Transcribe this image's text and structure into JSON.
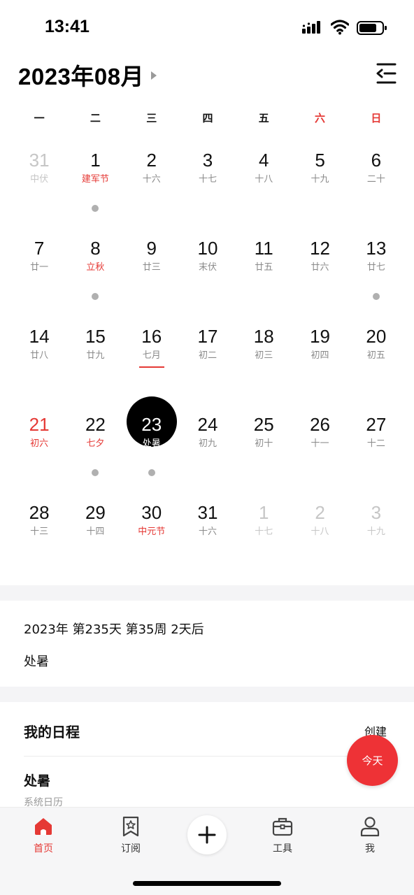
{
  "status": {
    "time": "13:41"
  },
  "header": {
    "month_title": "2023年08月"
  },
  "weekdays": [
    "一",
    "二",
    "三",
    "四",
    "五",
    "六",
    "日"
  ],
  "weeks": [
    [
      {
        "num": "31",
        "sub": "中伏",
        "other": true
      },
      {
        "num": "1",
        "sub": "建军节",
        "red_sub": true,
        "dot": true
      },
      {
        "num": "2",
        "sub": "十六"
      },
      {
        "num": "3",
        "sub": "十七"
      },
      {
        "num": "4",
        "sub": "十八"
      },
      {
        "num": "5",
        "sub": "十九"
      },
      {
        "num": "6",
        "sub": "二十"
      }
    ],
    [
      {
        "num": "7",
        "sub": "廿一"
      },
      {
        "num": "8",
        "sub": "立秋",
        "red_sub": true,
        "dot": true
      },
      {
        "num": "9",
        "sub": "廿三"
      },
      {
        "num": "10",
        "sub": "末伏"
      },
      {
        "num": "11",
        "sub": "廿五"
      },
      {
        "num": "12",
        "sub": "廿六"
      },
      {
        "num": "13",
        "sub": "廿七",
        "dot": true
      }
    ],
    [
      {
        "num": "14",
        "sub": "廿八"
      },
      {
        "num": "15",
        "sub": "廿九"
      },
      {
        "num": "16",
        "sub": "七月",
        "underline": true
      },
      {
        "num": "17",
        "sub": "初二"
      },
      {
        "num": "18",
        "sub": "初三"
      },
      {
        "num": "19",
        "sub": "初四"
      },
      {
        "num": "20",
        "sub": "初五"
      }
    ],
    [
      {
        "num": "21",
        "sub": "初六",
        "red_num": true,
        "red_sub": true
      },
      {
        "num": "22",
        "sub": "七夕",
        "red_sub": true,
        "dot": true
      },
      {
        "num": "23",
        "sub": "处暑",
        "selected": true,
        "dot": true
      },
      {
        "num": "24",
        "sub": "初九"
      },
      {
        "num": "25",
        "sub": "初十"
      },
      {
        "num": "26",
        "sub": "十一"
      },
      {
        "num": "27",
        "sub": "十二"
      }
    ],
    [
      {
        "num": "28",
        "sub": "十三"
      },
      {
        "num": "29",
        "sub": "十四"
      },
      {
        "num": "30",
        "sub": "中元节",
        "red_sub": true
      },
      {
        "num": "31",
        "sub": "十六"
      },
      {
        "num": "1",
        "sub": "十七",
        "other": true
      },
      {
        "num": "2",
        "sub": "十八",
        "other": true
      },
      {
        "num": "3",
        "sub": "十九",
        "other": true
      }
    ]
  ],
  "info": {
    "day_info": "2023年 第235天 第35周 2天后",
    "solar_term": "处暑"
  },
  "schedule": {
    "title": "我的日程",
    "create_label": "创建",
    "events": [
      {
        "title": "处暑",
        "subtitle": "系统日历"
      }
    ]
  },
  "today_button": "今天",
  "tabs": [
    {
      "label": "首页",
      "icon": "home-icon",
      "active": true
    },
    {
      "label": "订阅",
      "icon": "bookmark-star-icon"
    },
    {
      "label": "工具",
      "icon": "toolbox-icon"
    },
    {
      "label": "我",
      "icon": "person-icon"
    }
  ],
  "colors": {
    "accent": "#e53935",
    "fab": "#ee3236",
    "selected": "#000000"
  }
}
